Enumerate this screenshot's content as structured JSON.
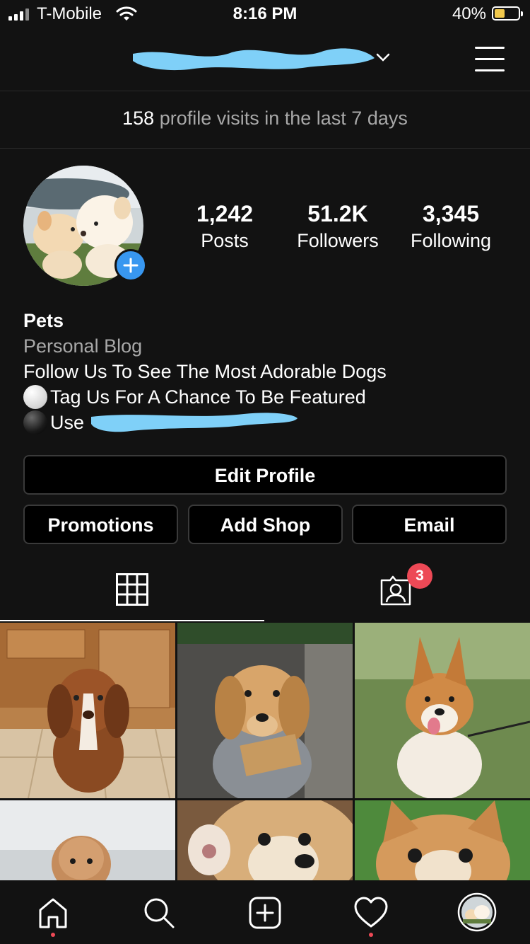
{
  "status_bar": {
    "carrier": "T-Mobile",
    "time": "8:16 PM",
    "battery_percent": "40%",
    "battery_level": 0.4
  },
  "header": {
    "username": "",
    "menu_icon": "hamburger-icon"
  },
  "insights": {
    "visits_count": "158",
    "visits_text": " profile visits in the last 7 days"
  },
  "stats": [
    {
      "value": "1,242",
      "label": "Posts"
    },
    {
      "value": "51.2K",
      "label": "Followers"
    },
    {
      "value": "3,345",
      "label": "Following"
    }
  ],
  "bio": {
    "name": "Pets",
    "category": "Personal Blog",
    "line1": "Follow Us To See The Most Adorable Dogs",
    "line2": "Tag Us For A Chance To Be Featured",
    "line3": "Use"
  },
  "buttons": {
    "edit_profile": "Edit Profile",
    "promotions": "Promotions",
    "add_shop": "Add Shop",
    "email": "Email"
  },
  "tabs": {
    "grid_icon": "grid-icon",
    "tagged_icon": "tagged-person-icon",
    "tagged_badge": "3"
  },
  "colors": {
    "background": "#121212",
    "accent_blue": "#3897f0",
    "badge_red": "#ed4956",
    "redaction_blue": "#7fd0f8"
  },
  "bottom_nav": [
    "home-icon",
    "search-icon",
    "new-post-icon",
    "heart-icon",
    "profile-avatar"
  ]
}
